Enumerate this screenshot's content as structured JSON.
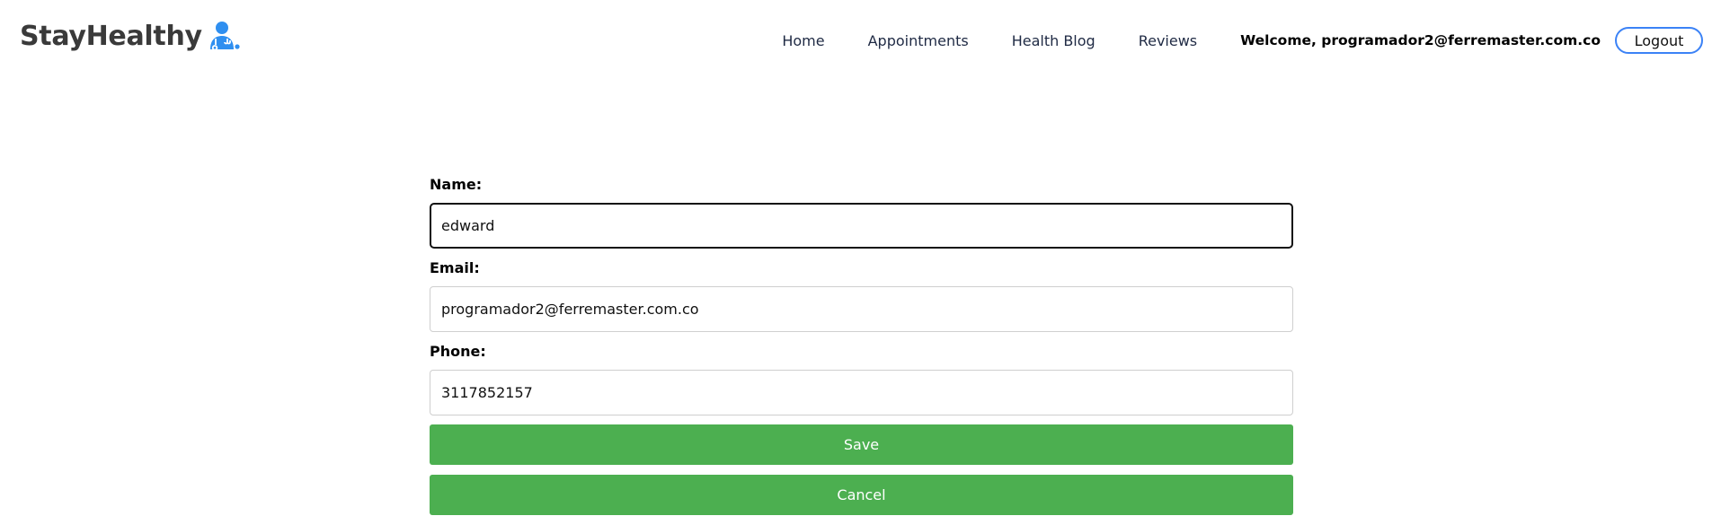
{
  "brand": {
    "name": "StayHealthy",
    "icon": "doctor-icon",
    "icon_color": "#2f8ff0"
  },
  "nav": {
    "items": [
      {
        "label": "Home"
      },
      {
        "label": "Appointments"
      },
      {
        "label": "Health Blog"
      },
      {
        "label": "Reviews"
      }
    ],
    "welcome": "Welcome, programador2@ferremaster.com.co",
    "logout_label": "Logout",
    "logout_border_color": "#3b82f6"
  },
  "form": {
    "name_label": "Name:",
    "name_value": "edward",
    "email_label": "Email:",
    "email_value": "programador2@ferremaster.com.co",
    "phone_label": "Phone:",
    "phone_value": "3117852157",
    "save_label": "Save",
    "cancel_label": "Cancel",
    "button_color": "#4caf50"
  }
}
